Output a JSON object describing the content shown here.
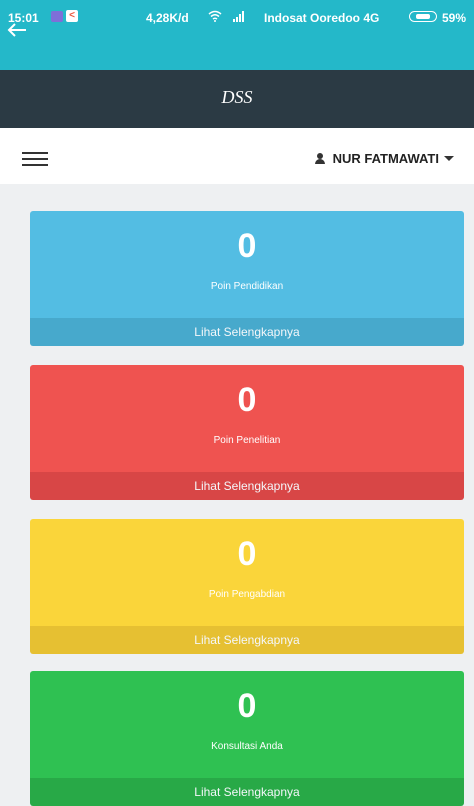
{
  "status_bar": {
    "time": "15:01",
    "speed": "4,28K/d",
    "carrier": "Indosat Ooredoo 4G",
    "battery": "59%"
  },
  "header": {
    "title": "DSS"
  },
  "navbar": {
    "user_name": "NUR FATMAWATI"
  },
  "cards": [
    {
      "count": "0",
      "label": "Poin Pendidikan",
      "footer": "Lihat Selengkapnya",
      "color": "#53bde3",
      "footer_color": "#47a9cc"
    },
    {
      "count": "0",
      "label": "Poin Penelitian",
      "footer": "Lihat Selengkapnya",
      "color": "#ef5350",
      "footer_color": "#d84646"
    },
    {
      "count": "0",
      "label": "Poin Pengabdian",
      "footer": "Lihat Selengkapnya",
      "color": "#fad53a",
      "footer_color": "#e6c032"
    },
    {
      "count": "0",
      "label": "Konsultasi Anda",
      "footer": "Lihat Selengkapnya",
      "color": "#2fc152",
      "footer_color": "#28a947"
    }
  ]
}
